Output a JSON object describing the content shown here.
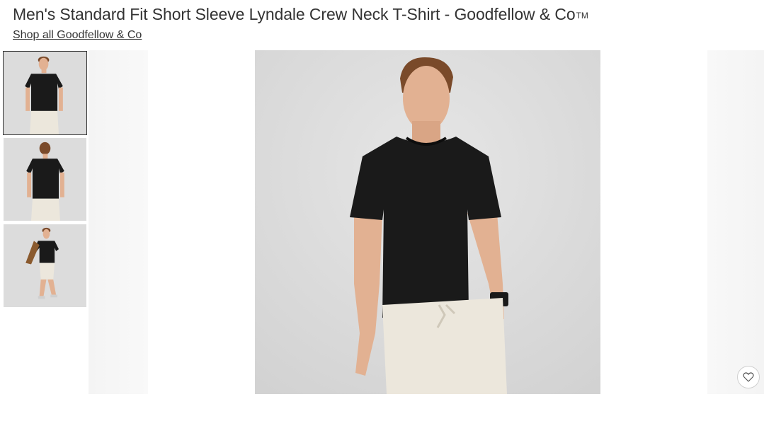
{
  "product": {
    "title": "Men's Standard Fit Short Sleeve Lyndale Crew Neck T-Shirt - Goodfellow & Co",
    "trademark": "TM",
    "shop_link": "Shop all Goodfellow & Co"
  },
  "gallery": {
    "thumbnails": [
      {
        "view": "front",
        "selected": true
      },
      {
        "view": "back",
        "selected": false
      },
      {
        "view": "walking",
        "selected": false
      }
    ],
    "favorite_icon": "heart-icon"
  },
  "colors": {
    "shirt": "#1a1a1a",
    "shorts": "#ece7dc",
    "background": "#dadada",
    "skin": "#e2b192",
    "hair": "#7a4a2a"
  }
}
